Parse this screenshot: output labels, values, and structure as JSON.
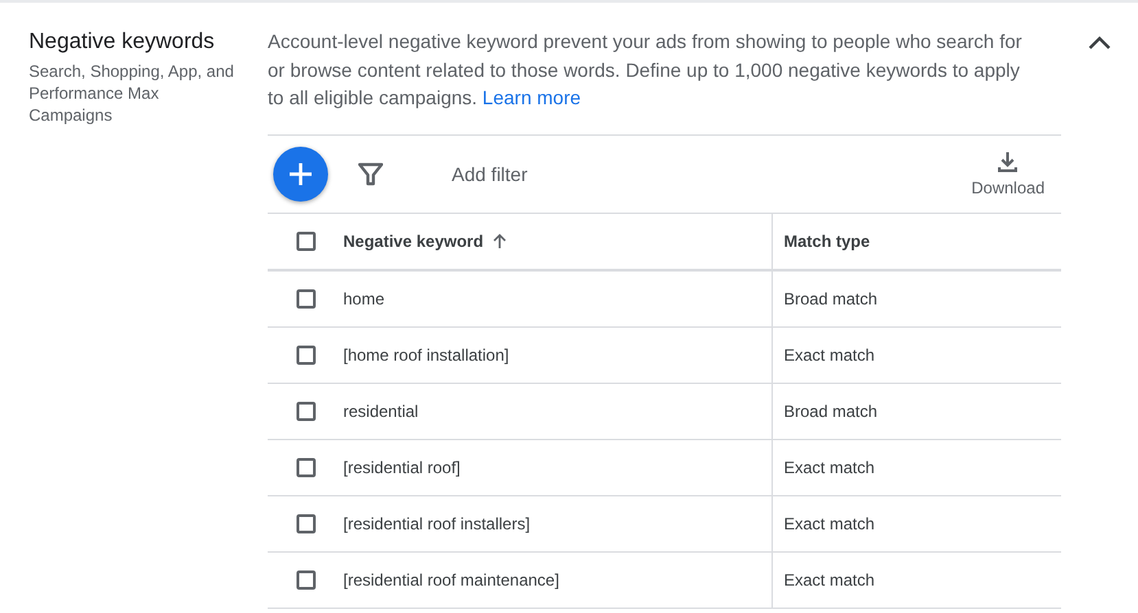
{
  "section": {
    "title": "Negative keywords",
    "subtitle": "Search, Shopping, App, and Performance Max Campaigns",
    "expanded": true
  },
  "description": {
    "text": "Account-level negative keyword prevent your ads from showing to people who search for or browse content related to those words. Define up to 1,000 negative keywords to apply to all eligible campaigns.",
    "link": "Learn more"
  },
  "toolbar": {
    "filter_label": "Add filter",
    "download_label": "Download"
  },
  "table": {
    "select_all_checked": false,
    "columns": [
      {
        "label": "Negative keyword",
        "sorted": true
      },
      {
        "label": "Match type",
        "sorted": false
      }
    ],
    "rows": [
      {
        "keyword": "home",
        "match_type": "Broad match",
        "checked": false
      },
      {
        "keyword": "[home roof installation]",
        "match_type": "Exact match",
        "checked": false
      },
      {
        "keyword": "residential",
        "match_type": "Broad match",
        "checked": false
      },
      {
        "keyword": "[residential roof]",
        "match_type": "Exact match",
        "checked": false
      },
      {
        "keyword": "[residential roof installers]",
        "match_type": "Exact match",
        "checked": false
      },
      {
        "keyword": "[residential roof maintenance]",
        "match_type": "Exact match",
        "checked": false
      }
    ]
  }
}
